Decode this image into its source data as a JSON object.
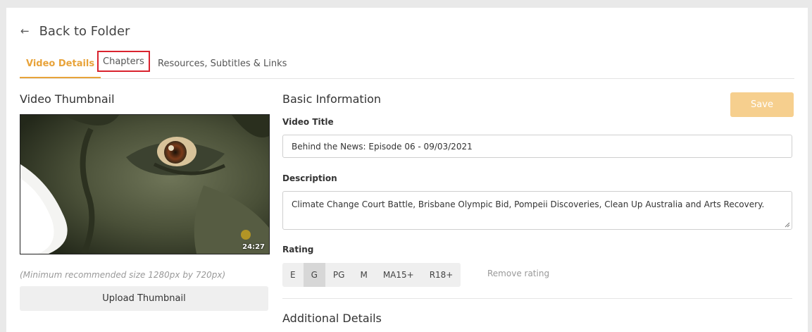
{
  "header": {
    "back_label": "Back to Folder"
  },
  "tabs": [
    {
      "label": "Video Details"
    },
    {
      "label": "Chapters"
    },
    {
      "label": "Resources, Subtitles & Links"
    }
  ],
  "thumbnail": {
    "title": "Video Thumbnail",
    "duration": "24:27",
    "hint": "(Minimum recommended size 1280px by 720px)",
    "upload_label": "Upload Thumbnail"
  },
  "basic": {
    "title": "Basic Information",
    "save_label": "Save",
    "video_title_label": "Video Title",
    "video_title_value": "Behind the News: Episode 06 - 09/03/2021",
    "description_label": "Description",
    "description_value": "Climate Change Court Battle, Brisbane Olympic Bid, Pompeii Discoveries, Clean Up Australia and Arts Recovery.",
    "rating_label": "Rating",
    "ratings": [
      "E",
      "G",
      "PG",
      "M",
      "MA15+",
      "R18+"
    ],
    "selected_rating": "G",
    "remove_rating_label": "Remove rating",
    "next_section_partial": "Additional Details"
  },
  "colors": {
    "accent": "#e8a33a",
    "save_disabled": "#f6cf8e",
    "highlight_outline": "#d9232e"
  }
}
